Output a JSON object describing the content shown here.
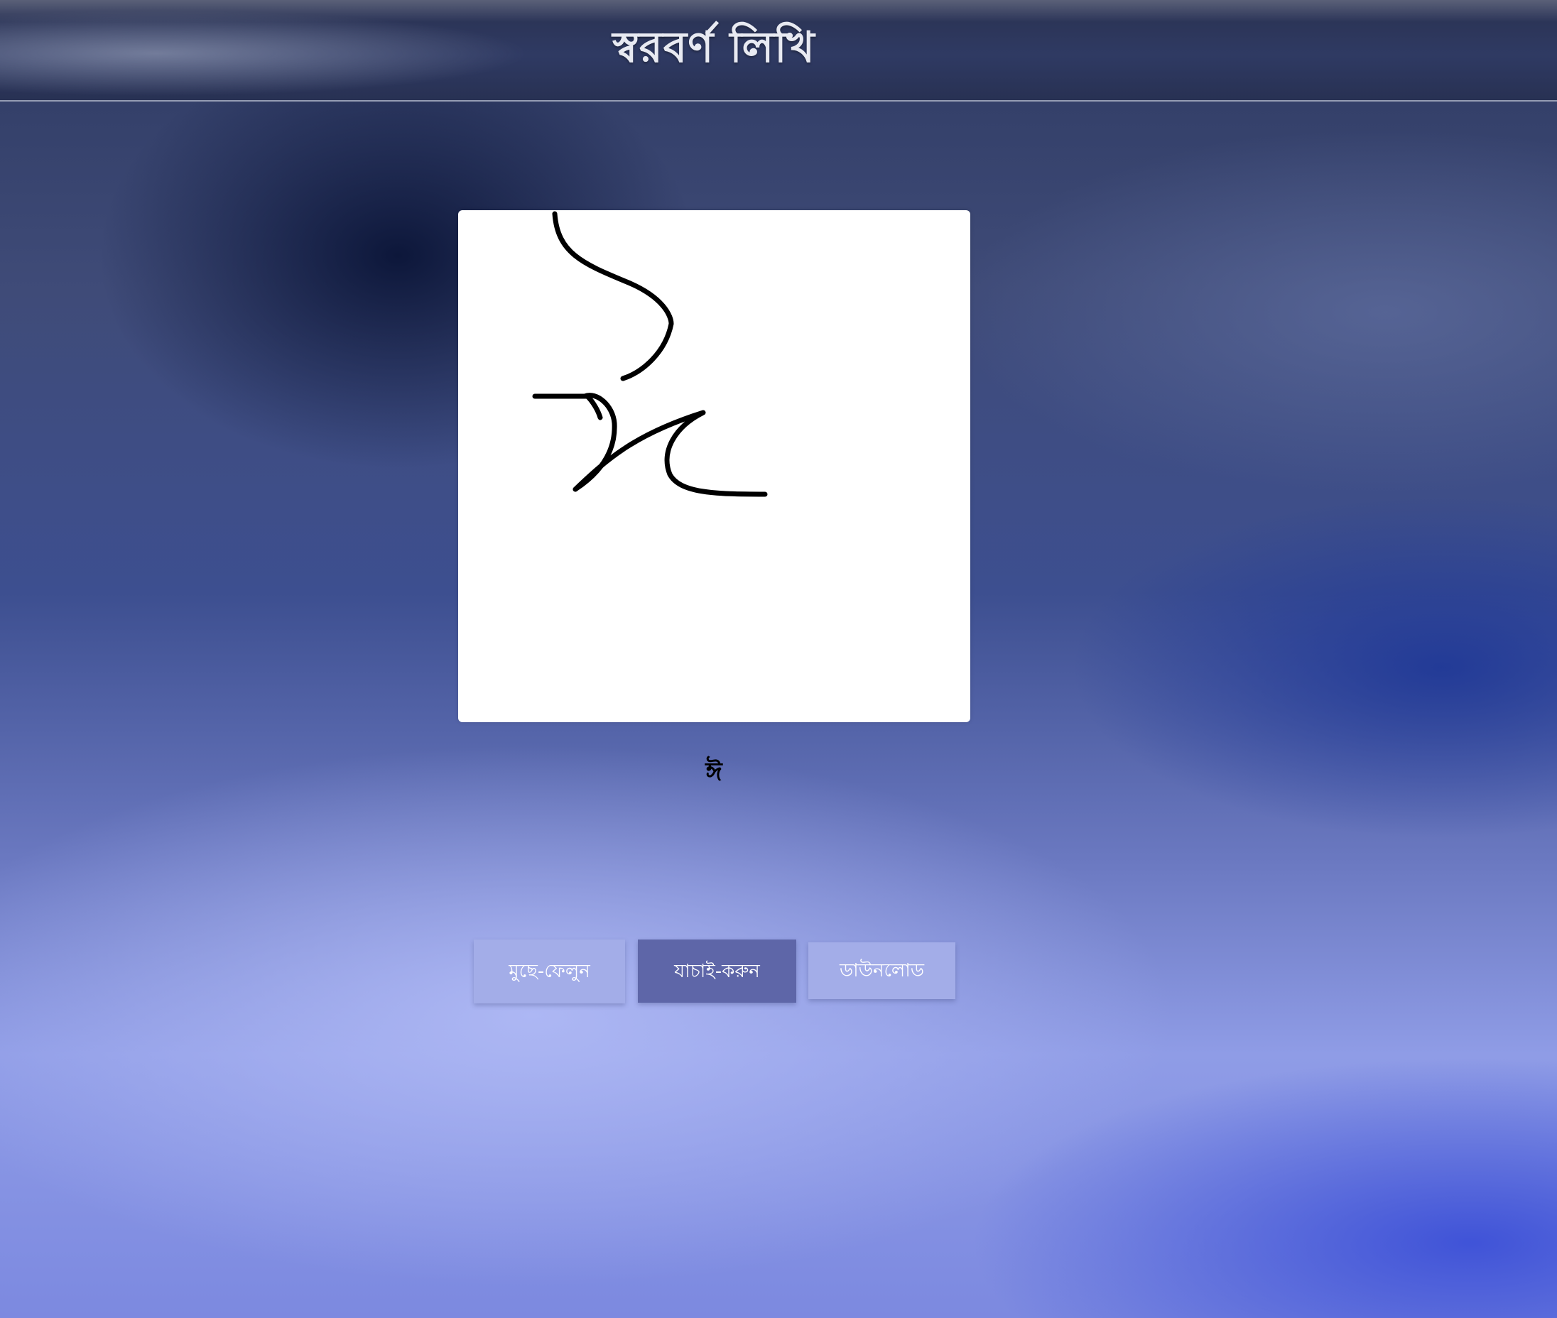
{
  "header": {
    "title": "স্বরবর্ণ লিখি"
  },
  "drawing_canvas": {
    "background": "#ffffff",
    "stroke_color": "#000000"
  },
  "result": {
    "recognized_letter": "ঈ"
  },
  "buttons": {
    "clear_label": "মুছে-ফেলুন",
    "check_label": "যাচাই-করুন",
    "download_label": "ডাউনলোড"
  },
  "colors": {
    "button_light": "#a3ade8",
    "button_dark": "#5e66a8",
    "header_bg": "#2f3a63"
  }
}
